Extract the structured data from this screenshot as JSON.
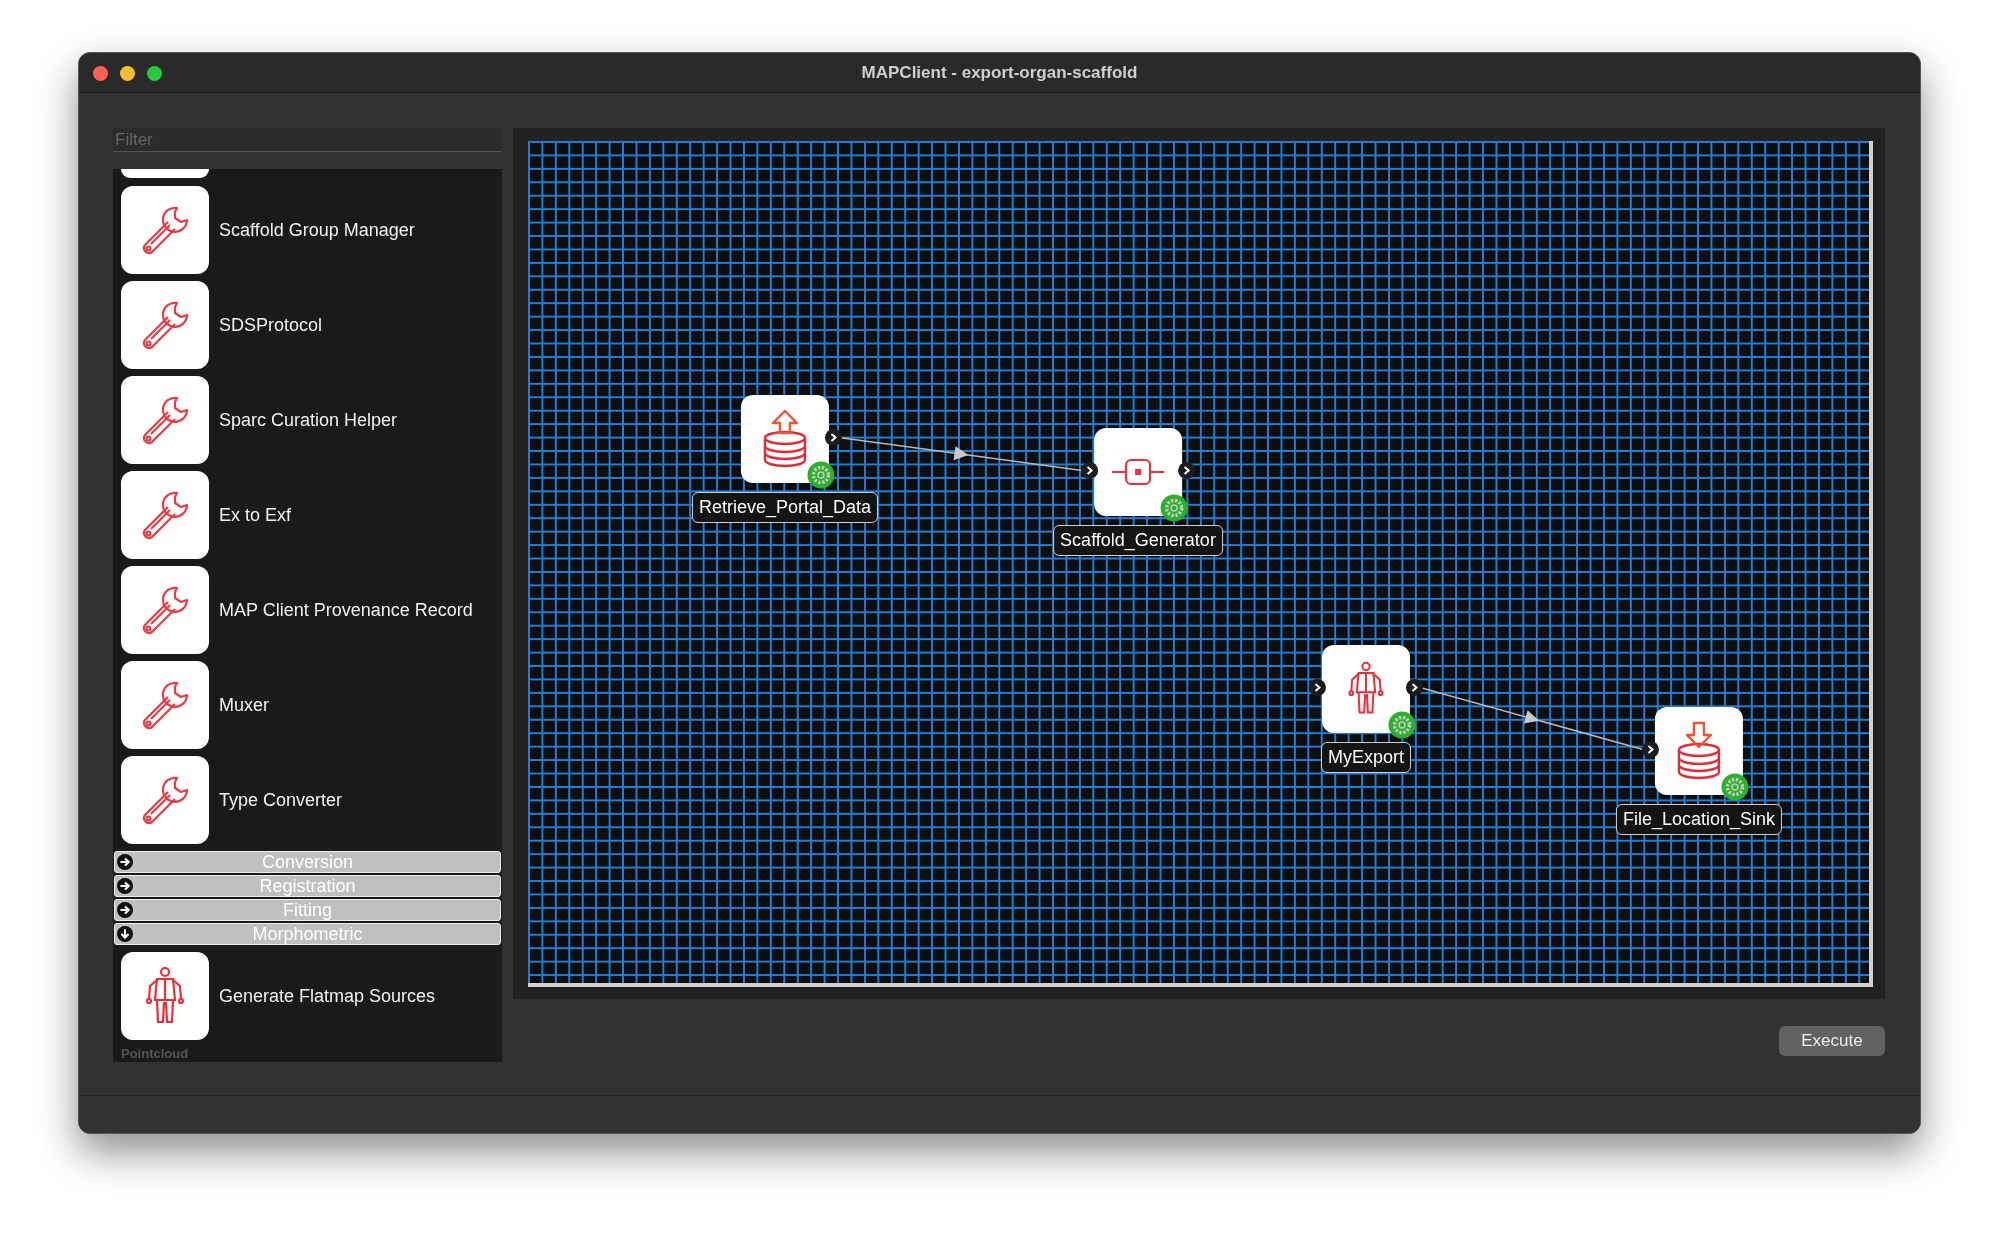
{
  "window": {
    "title": "MAPClient - export-organ-scaffold"
  },
  "sidebar": {
    "filter_placeholder": "Filter",
    "items": [
      {
        "kind": "stub"
      },
      {
        "kind": "wrench-step",
        "label": "Scaffold Group Manager"
      },
      {
        "kind": "wrench-step",
        "label": "SDSProtocol"
      },
      {
        "kind": "wrench-step",
        "label": "Sparc Curation Helper"
      },
      {
        "kind": "wrench-step",
        "label": "Ex to Exf"
      },
      {
        "kind": "wrench-step",
        "label": "MAP Client Provenance Record"
      },
      {
        "kind": "wrench-step",
        "label": "Muxer"
      },
      {
        "kind": "wrench-step",
        "label": "Type Converter"
      },
      {
        "kind": "category",
        "label": "Conversion",
        "expanded": false
      },
      {
        "kind": "category",
        "label": "Registration",
        "expanded": false
      },
      {
        "kind": "category",
        "label": "Fitting",
        "expanded": false
      },
      {
        "kind": "category",
        "label": "Morphometric",
        "expanded": true
      },
      {
        "kind": "body-step",
        "label": "Generate Flatmap Sources"
      },
      {
        "kind": "caption",
        "label": "Pointcloud"
      }
    ]
  },
  "workflow": {
    "nodes": [
      {
        "kind": "source",
        "label": "Retrieve_Portal_Data",
        "configured": true,
        "has_input_port": false,
        "has_output_port": true,
        "connected_to_next": true
      },
      {
        "kind": "component",
        "label": "Scaffold_Generator",
        "configured": true,
        "has_input_port": true,
        "has_output_port": true,
        "connected_to_next": false
      },
      {
        "kind": "body",
        "label": "MyExport",
        "configured": true,
        "has_input_port": true,
        "has_output_port": true,
        "connected_to_next": true
      },
      {
        "kind": "sink",
        "label": "File_Location_Sink",
        "configured": true,
        "has_input_port": true,
        "has_output_port": false,
        "connected_to_next": false
      }
    ]
  },
  "buttons": {
    "execute": "Execute"
  }
}
